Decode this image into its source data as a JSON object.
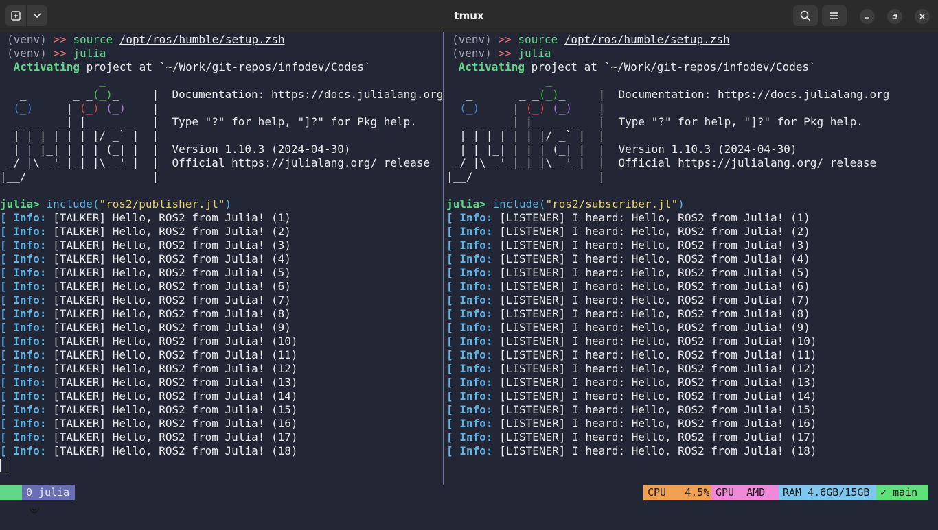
{
  "window": {
    "title": "tmux",
    "new_tab_icon": "new-tab-icon",
    "dropdown_icon": "chevron-down-icon",
    "search_icon": "search-icon",
    "menu_icon": "hamburger-menu-icon",
    "minimize_icon": "minimize-icon",
    "maximize_icon": "restore-icon",
    "close_icon": "close-icon"
  },
  "left_pane": {
    "prompt_venv": "(venv)",
    "prompt_arrow": ">>",
    "cmd1": "source",
    "cmd1_path": "/opt/ros/humble/setup.zsh",
    "cmd2": "julia",
    "activating_word": " Activating",
    "activating_rest": " project at `~/Work/git-repos/infodev/Codes`",
    "banner": {
      "l1": "               _",
      "l2a": "   _       _ _",
      "l2b": "(_)",
      "l2c": "_     |  Documentation: https://docs.julialang.org",
      "l3a": "  ",
      "l3b": "(_)",
      "l3c": "     | ",
      "l3d": "(_)",
      "l3e": " ",
      "l3f": "(_)",
      "l3g": "    |",
      "l4": "   _ _   _| |_  __ _   |  Type \"?\" for help, \"]?\" for Pkg help.",
      "l5": "  | | | | | | |/ _` |  |",
      "l6": "  | | |_| | | | (_| |  |  Version 1.10.3 (2024-04-30)",
      "l7": " _/ |\\__'_|_|_|\\__'_|  |  Official https://julialang.org/ release",
      "l8": "|__/                   |"
    },
    "julia_prompt": "julia>",
    "include_fn": "include(",
    "include_arg": "\"ros2/publisher.jl\"",
    "include_close": ")",
    "log_bracket": "[",
    "log_info": "Info:",
    "messages": [
      "[TALKER] Hello, ROS2 from Julia! (1)",
      "[TALKER] Hello, ROS2 from Julia! (2)",
      "[TALKER] Hello, ROS2 from Julia! (3)",
      "[TALKER] Hello, ROS2 from Julia! (4)",
      "[TALKER] Hello, ROS2 from Julia! (5)",
      "[TALKER] Hello, ROS2 from Julia! (6)",
      "[TALKER] Hello, ROS2 from Julia! (7)",
      "[TALKER] Hello, ROS2 from Julia! (8)",
      "[TALKER] Hello, ROS2 from Julia! (9)",
      "[TALKER] Hello, ROS2 from Julia! (10)",
      "[TALKER] Hello, ROS2 from Julia! (11)",
      "[TALKER] Hello, ROS2 from Julia! (12)",
      "[TALKER] Hello, ROS2 from Julia! (13)",
      "[TALKER] Hello, ROS2 from Julia! (14)",
      "[TALKER] Hello, ROS2 from Julia! (15)",
      "[TALKER] Hello, ROS2 from Julia! (16)",
      "[TALKER] Hello, ROS2 from Julia! (17)",
      "[TALKER] Hello, ROS2 from Julia! (18)"
    ]
  },
  "right_pane": {
    "include_arg": "\"ros2/subscriber.jl\"",
    "messages": [
      "[LISTENER] I heard: Hello, ROS2 from Julia! (1)",
      "[LISTENER] I heard: Hello, ROS2 from Julia! (2)",
      "[LISTENER] I heard: Hello, ROS2 from Julia! (3)",
      "[LISTENER] I heard: Hello, ROS2 from Julia! (4)",
      "[LISTENER] I heard: Hello, ROS2 from Julia! (5)",
      "[LISTENER] I heard: Hello, ROS2 from Julia! (6)",
      "[LISTENER] I heard: Hello, ROS2 from Julia! (7)",
      "[LISTENER] I heard: Hello, ROS2 from Julia! (8)",
      "[LISTENER] I heard: Hello, ROS2 from Julia! (9)",
      "[LISTENER] I heard: Hello, ROS2 from Julia! (10)",
      "[LISTENER] I heard: Hello, ROS2 from Julia! (11)",
      "[LISTENER] I heard: Hello, ROS2 from Julia! (12)",
      "[LISTENER] I heard: Hello, ROS2 from Julia! (13)",
      "[LISTENER] I heard: Hello, ROS2 from Julia! (14)",
      "[LISTENER] I heard: Hello, ROS2 from Julia! (15)",
      "[LISTENER] I heard: Hello, ROS2 from Julia! (16)",
      "[LISTENER] I heard: Hello, ROS2 from Julia! (17)",
      "[LISTENER] I heard: Hello, ROS2 from Julia! (18)"
    ]
  },
  "status_bar": {
    "session_icon": "smiley-icon",
    "session": "0 julia",
    "cpu_label": "CPU",
    "cpu_value": "4.5%",
    "gpu_label": "GPU",
    "gpu_value": "AMD",
    "ram_label": "RAM",
    "ram_value": "4.6GB/15GB",
    "branch_check": "✓",
    "branch": "main",
    "colors": {
      "session": "#5fd787",
      "window": "#6a6fb5",
      "cpu": "#f0a050",
      "gpu": "#f08ad8",
      "ram": "#7ec8f0",
      "branch": "#5fe07a"
    }
  }
}
